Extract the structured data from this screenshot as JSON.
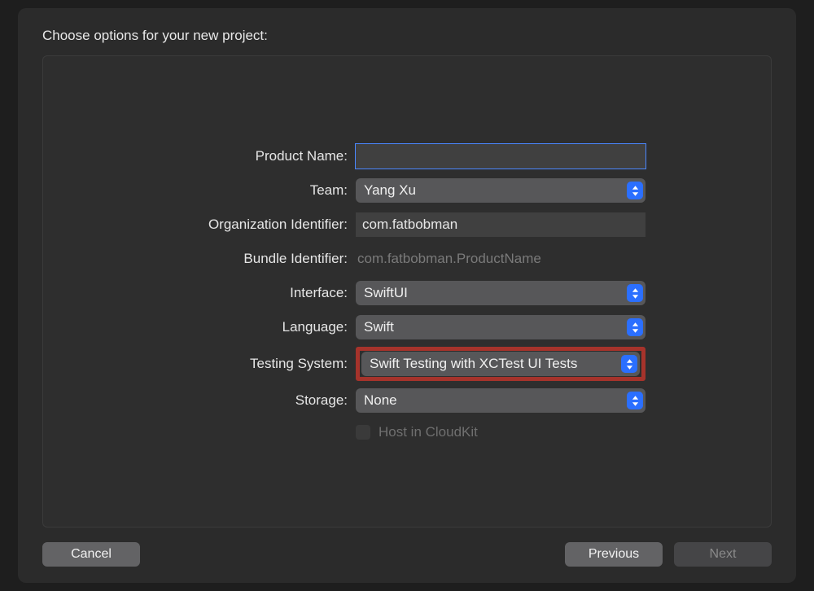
{
  "header": {
    "title": "Choose options for your new project:"
  },
  "labels": {
    "productName": "Product Name:",
    "team": "Team:",
    "orgIdentifier": "Organization Identifier:",
    "bundleIdentifier": "Bundle Identifier:",
    "interface": "Interface:",
    "language": "Language:",
    "testingSystem": "Testing System:",
    "storage": "Storage:",
    "hostInCloudkit": "Host in CloudKit"
  },
  "values": {
    "productName": "",
    "team": "Yang Xu",
    "orgIdentifier": "com.fatbobman",
    "bundleIdentifier": "com.fatbobman.ProductName",
    "interface": "SwiftUI",
    "language": "Swift",
    "testingSystem": "Swift Testing with XCTest UI Tests",
    "storage": "None",
    "hostInCloudkit": false
  },
  "footer": {
    "cancel": "Cancel",
    "previous": "Previous",
    "next": "Next"
  }
}
